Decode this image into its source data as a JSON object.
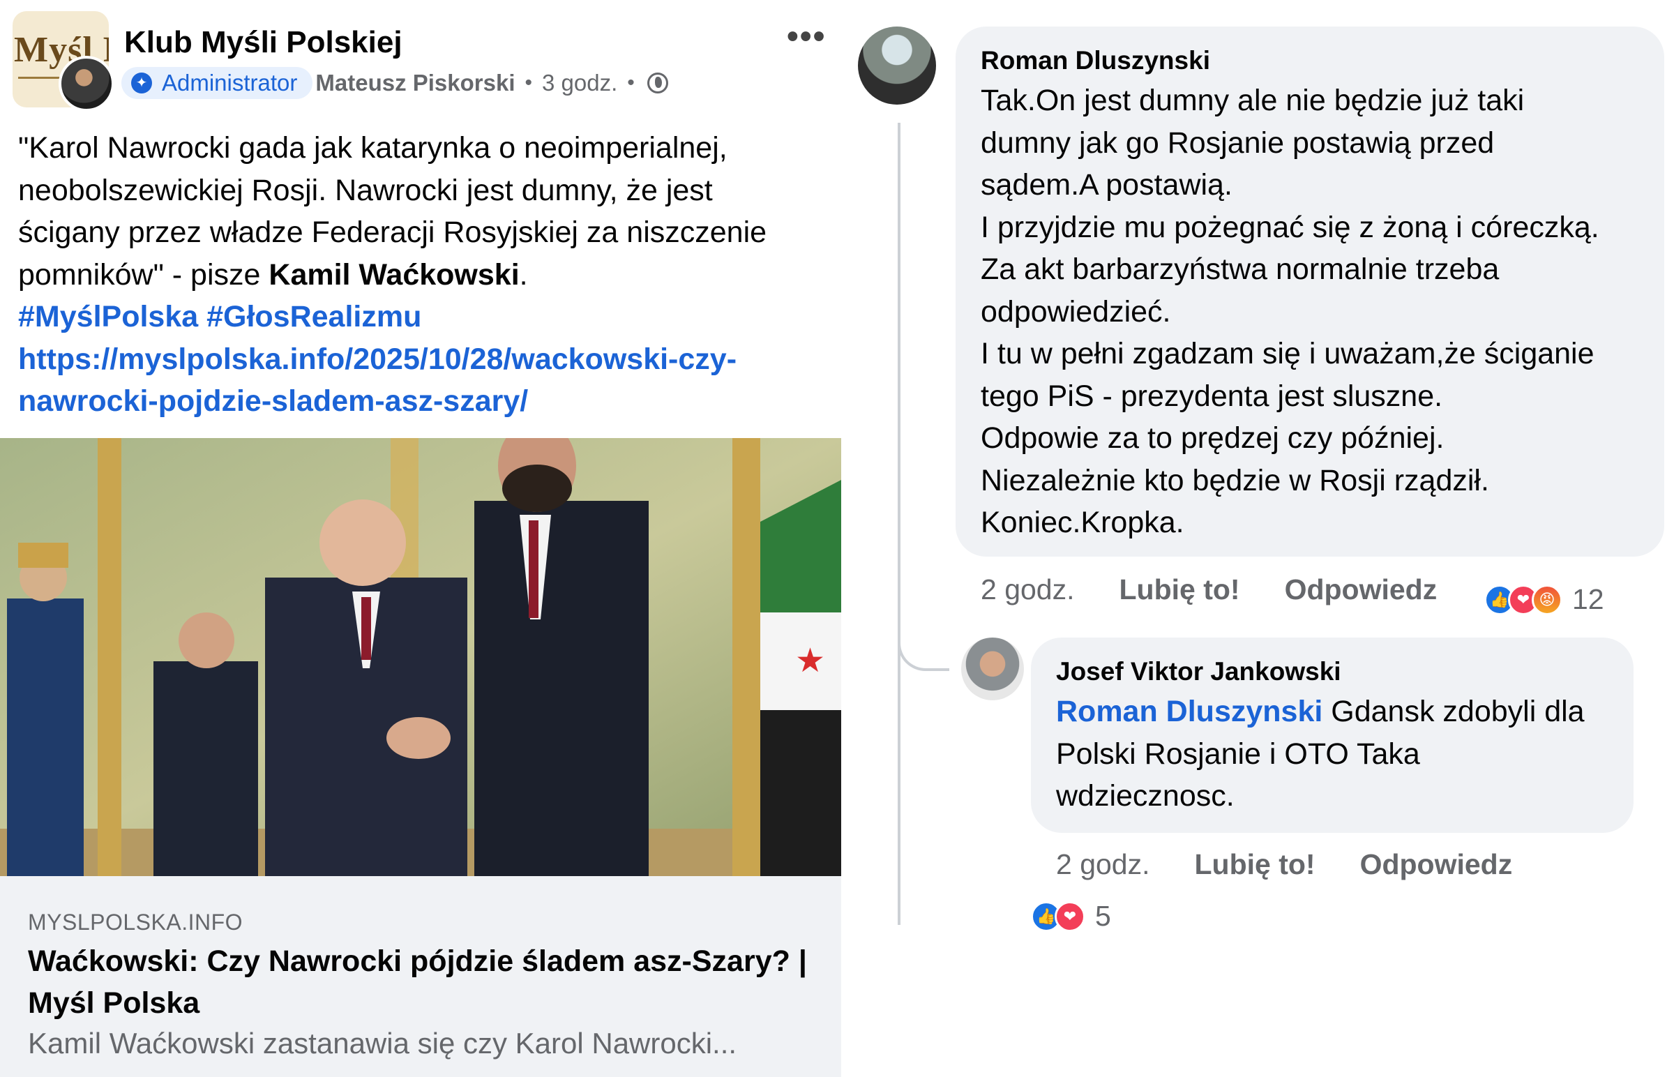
{
  "post": {
    "group_name": "Klub Myśli Polskiej",
    "group_logo_text": "Myśl Polska",
    "admin_badge": "Administrator",
    "author": "Mateusz Piskorski",
    "separator": "•",
    "time": "3 godz.",
    "text_lines": [
      "\"Karol Nawrocki gada jak katarynka o neoimperialnej,",
      "neobolszewickiej Rosji. Nawrocki jest dumny, że jest",
      "ścigany przez władze Federacji Rosyjskiej za niszczenie"
    ],
    "text_line4_prefix": "pomników\" - pisze ",
    "text_line4_bold": "Kamil Waćkowski",
    "text_line4_suffix": ".",
    "hashtags": "#MyślPolska #GłosRealizmu",
    "url_lines": [
      "https://myslpolska.info/2025/10/28/wackowski-czy-",
      "nawrocki-pojdzie-sladem-asz-szary/"
    ],
    "link_preview": {
      "domain": "MYSLPOLSKA.INFO",
      "title": "Waćkowski: Czy Nawrocki pójdzie śladem asz-Szary? | Myśl Polska",
      "description": "Kamil Waćkowski zastanawia się czy Karol Nawrocki..."
    }
  },
  "comments": [
    {
      "author": "Roman Dluszynski",
      "text_lines": [
        "Tak.On jest dumny ale nie będzie już taki",
        "dumny jak go Rosjanie postawią przed",
        "sądem.A postawią.",
        "I przyjdzie mu pożegnać się z żoną i córeczką.",
        "Za akt barbarzyństwa normalnie trzeba",
        "odpowiedzieć.",
        "I tu w pełni zgadzam się i uważam,że ściganie",
        "tego PiS - prezydenta jest sluszne.",
        "Odpowie za to prędzej czy później.",
        "Niezależnie kto będzie w Rosji rządził.",
        "Koniec.Kropka."
      ],
      "time": "2 godz.",
      "like_label": "Lubię to!",
      "reply_label": "Odpowiedz",
      "reaction_count": "12",
      "reactions": [
        "like",
        "love",
        "angry"
      ]
    },
    {
      "author": "Josef Viktor Jankowski",
      "mention": "Roman Dluszynski",
      "text_line1_rest": " Gdansk zdobyli dla",
      "text_lines": [
        "Polski Rosjanie i OTO Taka",
        "wdziecznosc."
      ],
      "time": "2 godz.",
      "like_label": "Lubię to!",
      "reply_label": "Odpowiedz",
      "reaction_count": "5",
      "reactions": [
        "like",
        "love"
      ]
    }
  ],
  "icons": {
    "more": "more-options-icon",
    "globe": "globe-icon",
    "admin": "admin-badge-icon",
    "like_glyph": "👍",
    "love_glyph": "❤",
    "angry_glyph": "😡"
  },
  "colors": {
    "link_blue": "#1b63d6",
    "secondary_text": "#65676b",
    "bubble_bg": "#f0f2f5",
    "admin_badge_bg": "#e7f0fd"
  }
}
